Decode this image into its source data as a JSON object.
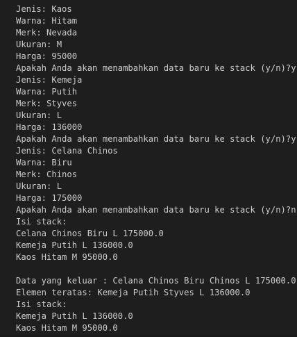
{
  "terminal": {
    "top_fragment": "",
    "lines": [
      "Jenis: Kaos",
      "Warna: Hitam",
      "Merk: Nevada",
      "Ukuran: M",
      "Harga: 95000",
      "Apakah Anda akan menambahkan data baru ke stack (y/n)?y",
      "Jenis: Kemeja",
      "Warna: Putih",
      "Merk: Styves",
      "Ukuran: L",
      "Harga: 136000",
      "Apakah Anda akan menambahkan data baru ke stack (y/n)?y",
      "Jenis: Celana Chinos",
      "Warna: Biru",
      "Merk: Chinos",
      "Ukuran: L",
      "Harga: 175000",
      "Apakah Anda akan menambahkan data baru ke stack (y/n)?n",
      "Isi stack:",
      "Celana Chinos Biru L 175000.0",
      "Kemeja Putih L 136000.0",
      "Kaos Hitam M 95000.0",
      "",
      "Data yang keluar : Celana Chinos Biru Chinos L 175000.0",
      "Elemen teratas: Kemeja Putih Styves L 136000.0",
      "Isi stack:",
      "Kemeja Putih L 136000.0",
      "Kaos Hitam M 95000.0"
    ]
  }
}
